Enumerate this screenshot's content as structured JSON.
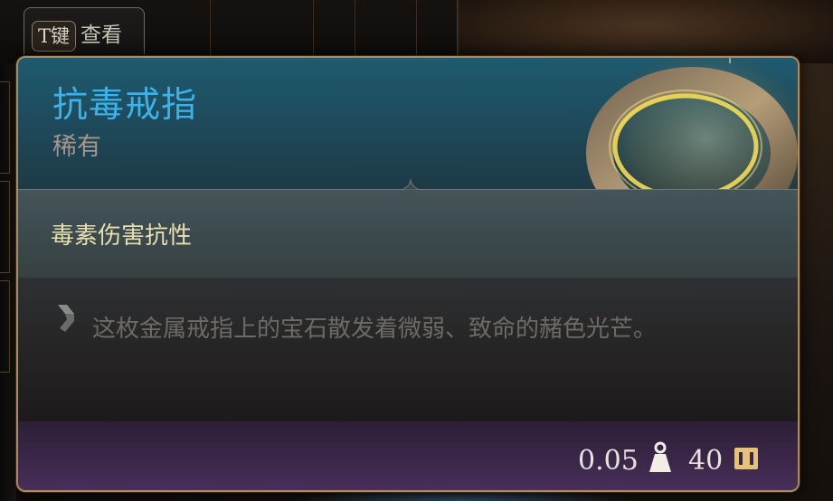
{
  "hint": {
    "key": "T键",
    "label": "查看"
  },
  "item": {
    "name": "抗毒戒指",
    "rarity": "稀有",
    "property": "毒素伤害抗性",
    "description": "这枚金属戒指上的宝石散发着微弱、致命的赭色光芒。",
    "weight": "0.05",
    "value": "40"
  },
  "colors": {
    "title": "#3ab3ea",
    "rarity": "#a8958c",
    "property": "#e8dfb0",
    "description": "#6e6a66",
    "border": "#b08a59"
  },
  "icons": {
    "weight": "weight-icon",
    "value": "gold-coin-icon",
    "description": "scroll-icon"
  }
}
